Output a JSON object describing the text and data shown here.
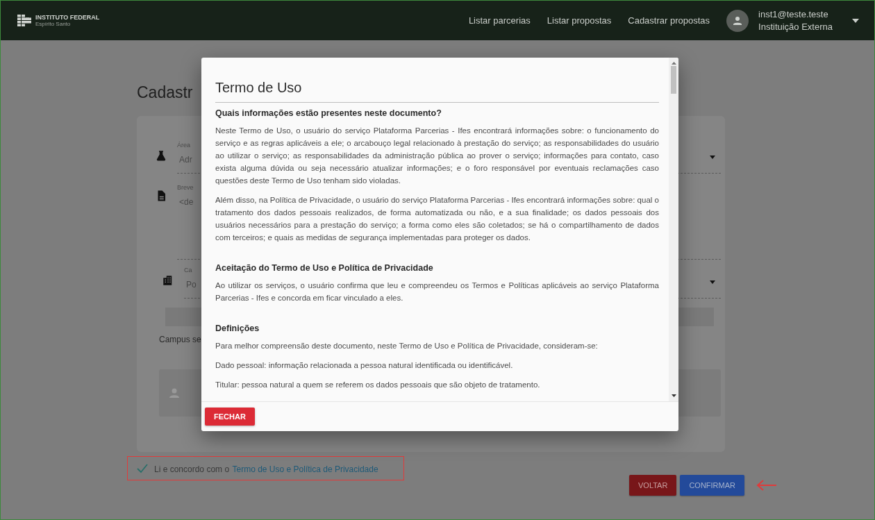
{
  "header": {
    "logo": {
      "name": "INSTITUTO FEDERAL",
      "subtitle": "Espírito Santo"
    },
    "nav": [
      "Listar parcerias",
      "Listar propostas",
      "Cadastrar propostas"
    ],
    "user": {
      "email": "inst1@teste.teste",
      "role": "Instituição Externa"
    }
  },
  "page": {
    "title": "Cadastr",
    "fields": [
      {
        "kind": "select",
        "label": "Área",
        "value": "Adr"
      },
      {
        "kind": "textarea",
        "label": "Breve",
        "value": "<de"
      },
      {
        "kind": "select",
        "label": "Ca",
        "value": "Po"
      }
    ],
    "campus_label": "Campus se",
    "agreement": {
      "checked": true,
      "text": "Li e concordo com o",
      "link": "Termo de Uso e Política de Privacidade"
    },
    "buttons": [
      {
        "kind": "back",
        "label": "VOLTAR"
      },
      {
        "kind": "confirm",
        "label": "CONFIRMAR"
      }
    ]
  },
  "dialog": {
    "title": "Termo de Uso",
    "sections": [
      {
        "heading": "Quais informações estão presentes neste documento?",
        "paragraphs": [
          "Neste Termo de Uso, o usuário do serviço Plataforma Parcerias - Ifes encontrará informações sobre: o funcionamento do serviço e as regras aplicáveis a ele; o arcabouço legal relacionado à prestação do serviço; as responsabilidades do usuário ao utilizar o serviço; as responsabilidades da administração pública ao prover o serviço; informações para contato, caso exista alguma dúvida ou seja necessário atualizar informações; e o foro responsável por eventuais reclamações caso questões deste Termo de Uso tenham sido violadas.",
          "Além disso, na Política de Privacidade, o usuário do serviço Plataforma Parcerias - Ifes encontrará informações sobre: qual o tratamento dos dados pessoais realizados, de forma automatizada ou não, e a sua finalidade; os dados pessoais dos usuários necessários para a prestação do serviço; a forma como eles são coletados; se há o compartilhamento de dados com terceiros; e quais as medidas de segurança implementadas para proteger os dados."
        ]
      },
      {
        "heading": "Aceitação do Termo de Uso e Política de Privacidade",
        "paragraphs": [
          "Ao utilizar os serviços, o usuário confirma que leu e compreendeu os Termos e Políticas aplicáveis ao serviço Plataforma Parcerias - Ifes e concorda em ficar vinculado a eles."
        ]
      },
      {
        "heading": "Definições",
        "paragraphs": [
          "Para melhor compreensão deste documento, neste Termo de Uso e Política de Privacidade, consideram-se:",
          "Dado pessoal: informação relacionada a pessoa natural identificada ou identificável.",
          "Titular: pessoa natural a quem se referem os dados pessoais que são objeto de tratamento."
        ]
      }
    ],
    "close_button": "FECHAR"
  }
}
